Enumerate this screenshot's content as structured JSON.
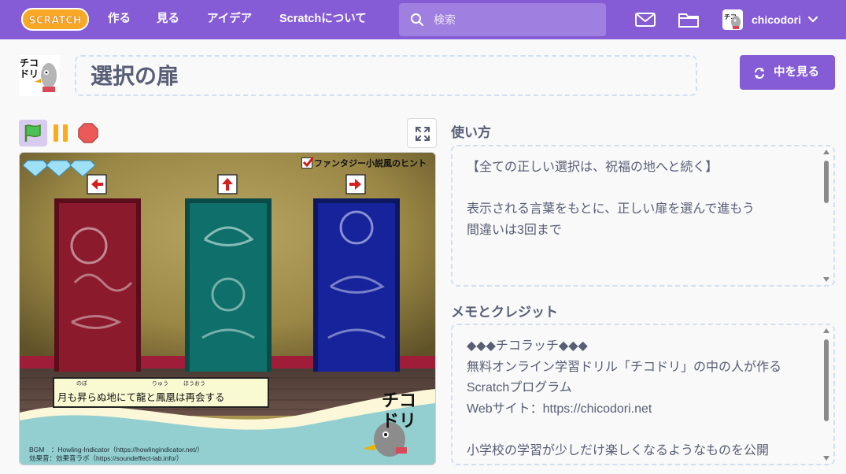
{
  "nav": {
    "logo_text": "SCRATCH",
    "links": [
      "作る",
      "見る",
      "アイデア",
      "Scratchについて"
    ],
    "search_placeholder": "検索",
    "username": "chicodori"
  },
  "project": {
    "title": "選択の扉",
    "see_inside_label": "中を見る",
    "avatar_text": "チコドリ"
  },
  "stage": {
    "checkbox_label": "ファンタジー小説風のヒント",
    "hint_ruby": [
      "のぼ",
      "りゅう",
      "ほうおう"
    ],
    "hint_text": "月も昇らぬ地にて龍と鳳凰は再会する",
    "credit_bgm": "BGM　：Howling-Indicator（https://howlingindicator.net/）",
    "credit_se": "効果音：効果音ラボ（https://soundeffect-lab.info/）",
    "logo_mark": "チコドリ",
    "lives": 3,
    "door_colors": [
      "#8b1a2c",
      "#0f6f6a",
      "#16239a"
    ],
    "arrows": [
      "←",
      "↑",
      "→"
    ]
  },
  "instructions": {
    "title": "使い方",
    "text": "【全ての正しい選択は、祝福の地へと続く】\n\n表示される言葉をもとに、正しい扉を選んで進もう\n間違いは3回まで"
  },
  "notes": {
    "title": "メモとクレジット",
    "text": "◆◆◆チコラッチ◆◆◆\n無料オンライン学習ドリル「チコドリ」の中の人が作るScratchプログラム\nWebサイト：https://chicodori.net\n\n小学校の学習が少しだけ楽しくなるようなものを公開"
  },
  "colors": {
    "brand": "#855cd6",
    "text": "#575e75",
    "dashed_border": "#cfe0f4"
  }
}
